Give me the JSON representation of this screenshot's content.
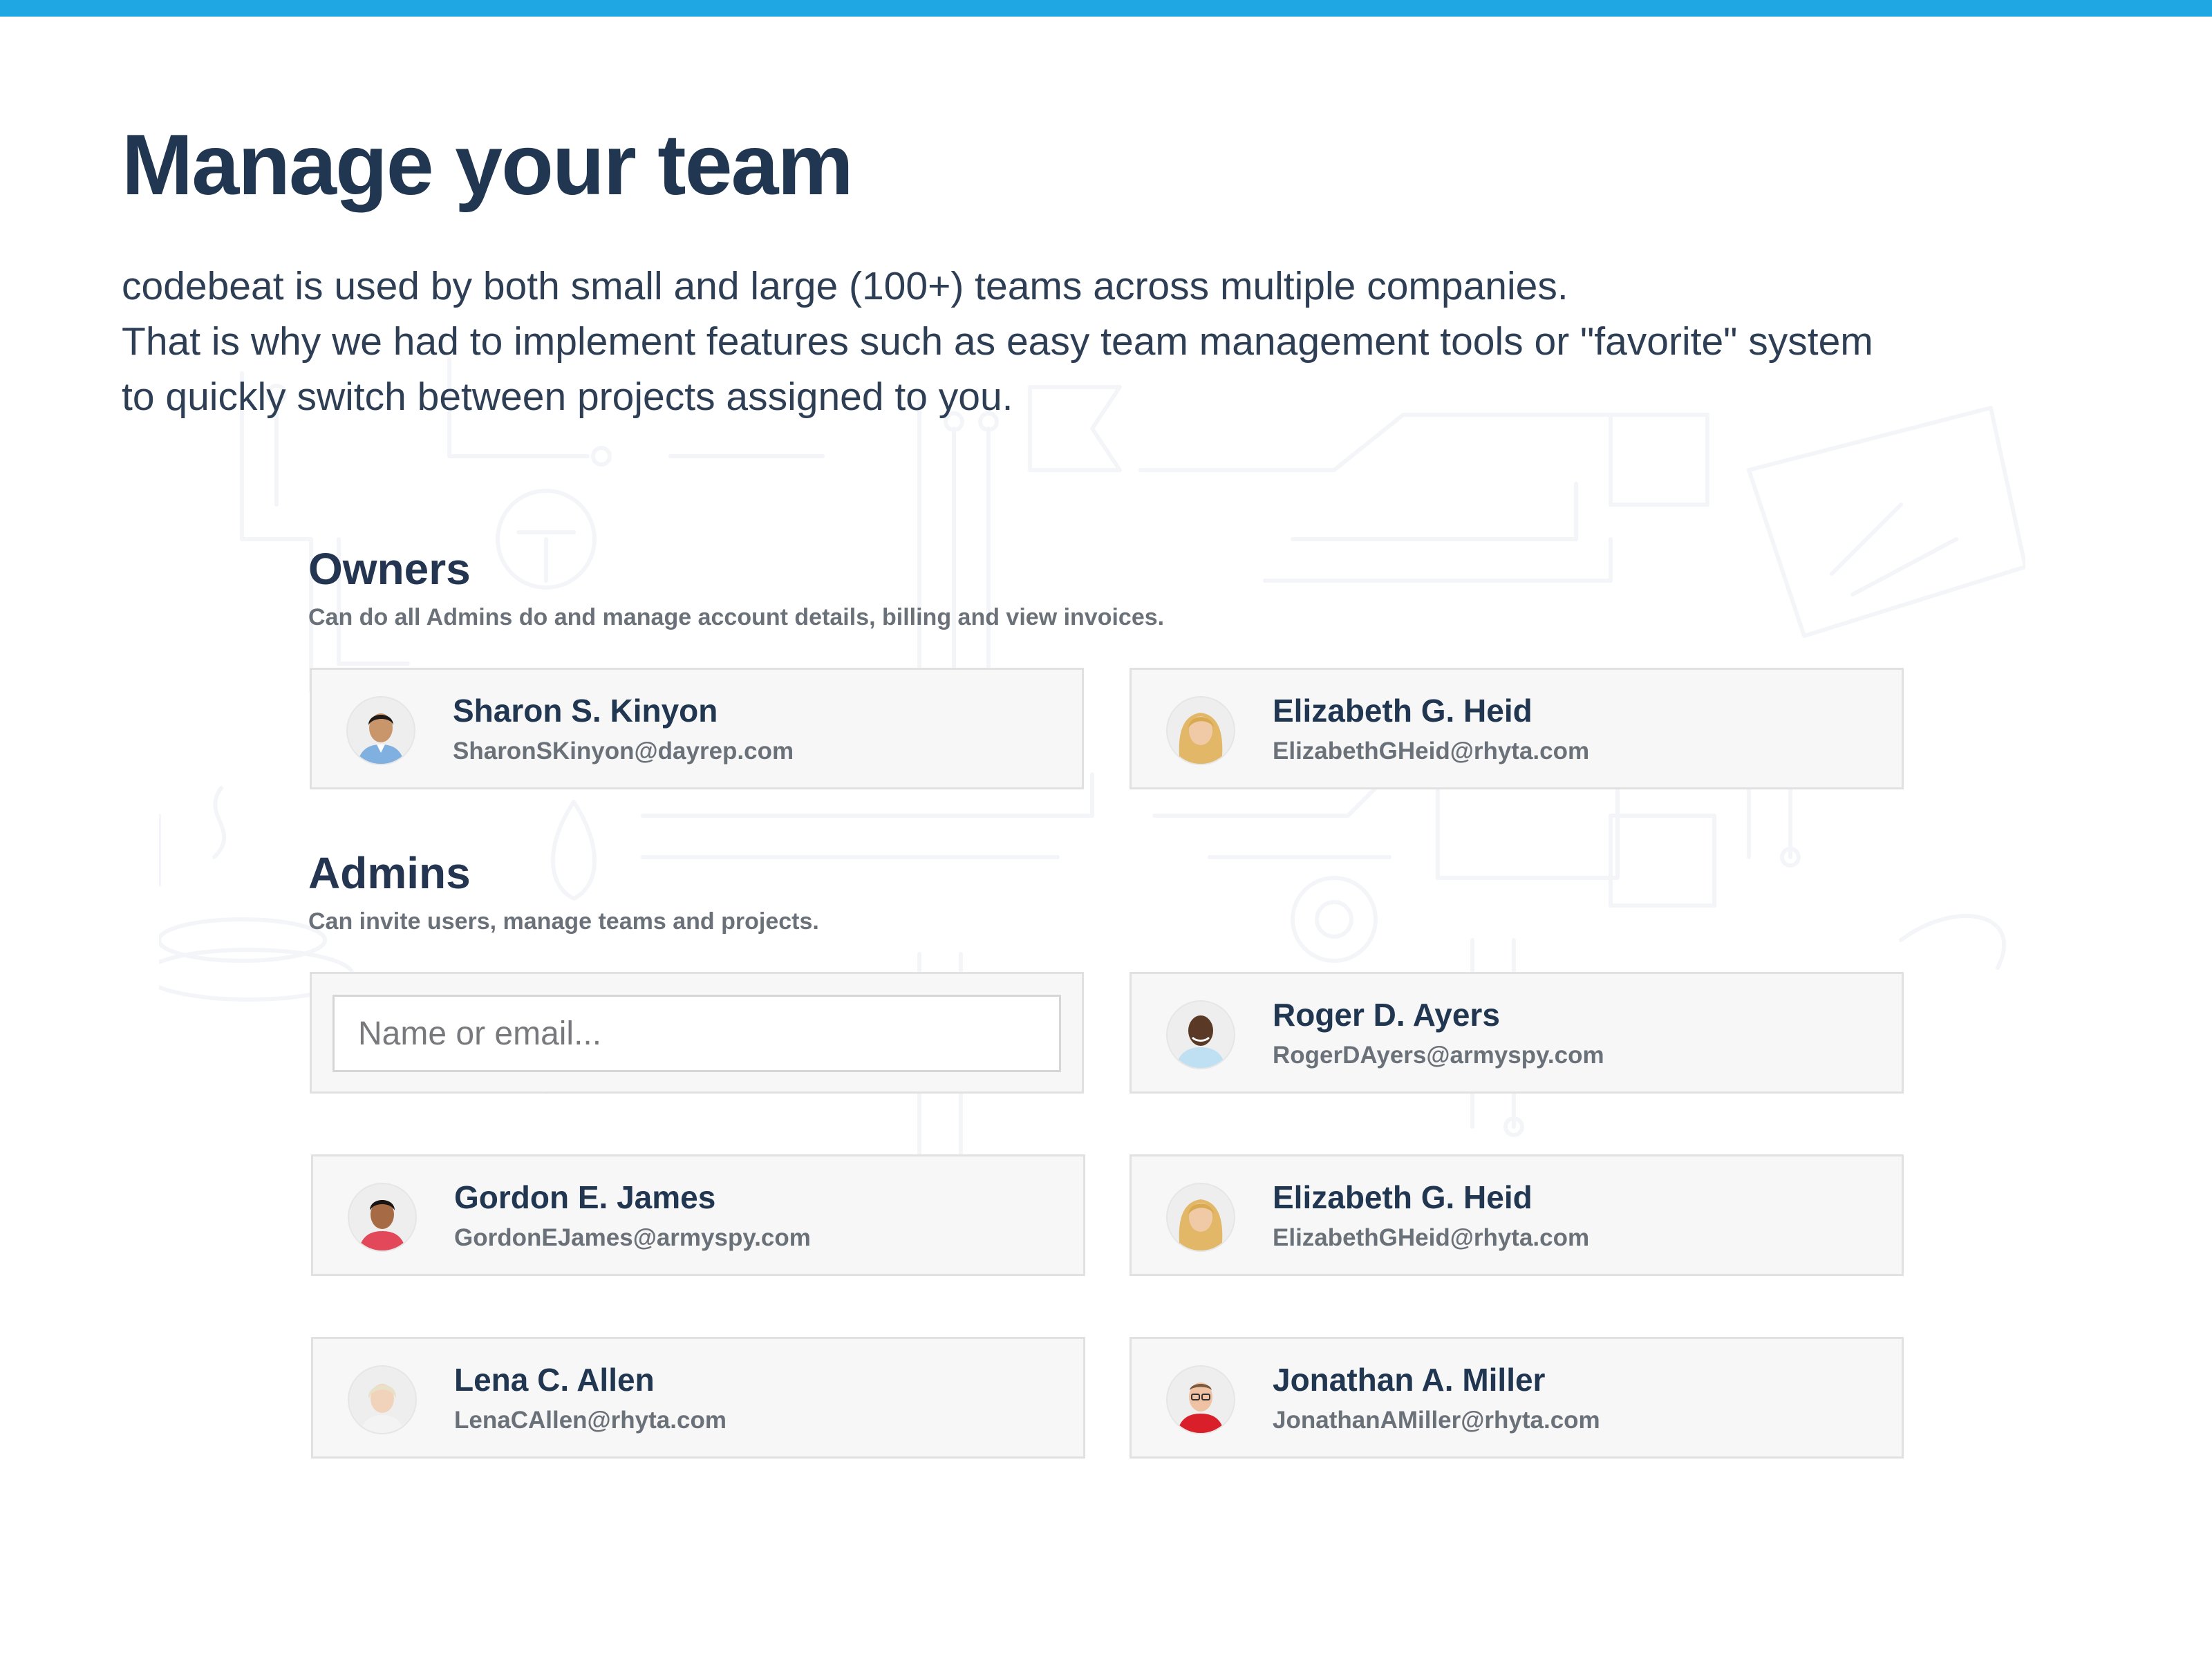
{
  "colors": {
    "accent": "#1fa7e3",
    "heading": "#213650",
    "text": "#2d3e55",
    "muted": "#6b7179",
    "card_bg": "#f7f7f7",
    "card_border": "#e1e1e1",
    "pattern": "#e9edf2"
  },
  "page": {
    "title": "Manage your team",
    "intro": [
      "codebeat is used by both small and large (100+) teams across multiple companies.",
      "That is why we had to implement features such as easy team management tools or \"favorite\" system",
      "to quickly switch between projects assigned to you."
    ]
  },
  "owners": {
    "title": "Owners",
    "description": "Can do all Admins do and manage account details, billing and view invoices.",
    "members": [
      {
        "name": "Sharon S. Kinyon",
        "email": "SharonSKinyon@dayrep.com",
        "avatar": "man-dark-hair-blue-shirt"
      },
      {
        "name": "Elizabeth G. Heid",
        "email": "ElizabethGHeid@rhyta.com",
        "avatar": "woman-blonde-hair"
      }
    ]
  },
  "admins": {
    "title": "Admins",
    "description": "Can invite users, manage teams and projects.",
    "search": {
      "placeholder": "Name or email...",
      "value": ""
    },
    "members": [
      {
        "name": "Roger D. Ayers",
        "email": "RogerDAyers@armyspy.com",
        "avatar": "man-dark-skin-light-blue-shirt"
      },
      {
        "name": "Gordon E. James",
        "email": "GordonEJames@armyspy.com",
        "avatar": "man-dark-hair-red-shirt"
      },
      {
        "name": "Elizabeth G. Heid",
        "email": "ElizabethGHeid@rhyta.com",
        "avatar": "woman-blonde-hair"
      },
      {
        "name": "Lena C. Allen",
        "email": "LenaCAllen@rhyta.com",
        "avatar": "woman-light-hair"
      },
      {
        "name": "Jonathan A. Miller",
        "email": "JonathanAMiller@rhyta.com",
        "avatar": "man-glasses-red-shirt"
      }
    ]
  }
}
